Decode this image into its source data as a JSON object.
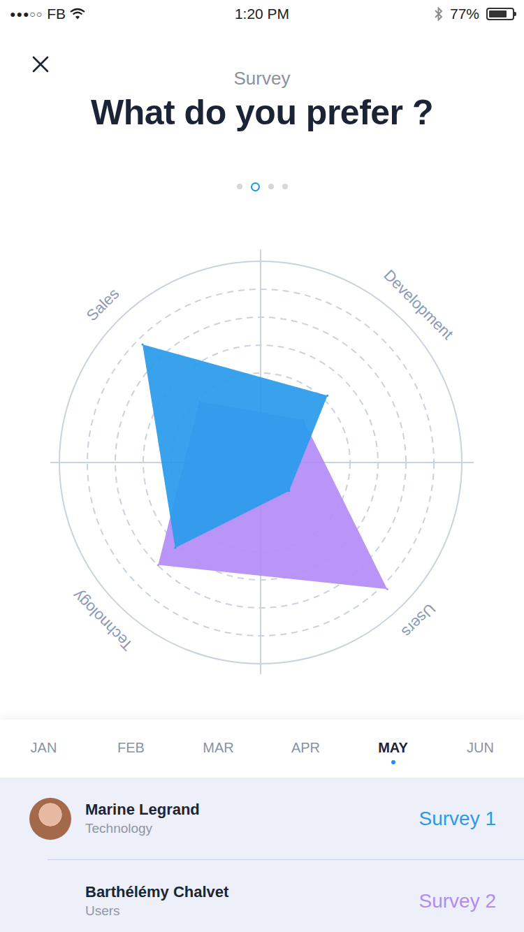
{
  "status_bar": {
    "signal": "●●●○○",
    "carrier": "FB",
    "time": "1:20 PM",
    "battery": "77%",
    "battery_level": 0.77
  },
  "header": {
    "subtitle": "Survey",
    "title": "What do you prefer ?"
  },
  "pager": [
    {
      "selected": false
    },
    {
      "selected": true
    },
    {
      "selected": false
    },
    {
      "selected": false
    }
  ],
  "chart": {
    "axes": [
      "Sales",
      "Development",
      "Users",
      "Technology"
    ],
    "max": 100,
    "series": [
      {
        "color": "#b48ff6",
        "values": [
          43,
          30,
          89,
          72
        ]
      },
      {
        "color": "#2a9bec",
        "values": [
          83,
          47,
          20,
          60
        ]
      }
    ]
  },
  "months": [
    {
      "label": "JAN",
      "selected": false
    },
    {
      "label": "FEB",
      "selected": false
    },
    {
      "label": "MAR",
      "selected": false
    },
    {
      "label": "APR",
      "selected": false
    },
    {
      "label": "MAY",
      "selected": true
    },
    {
      "label": "JUN",
      "selected": false
    }
  ],
  "people": [
    {
      "name": "Marine Legrand",
      "role": "Technology",
      "survey": "Survey 1",
      "color": "#2b9ae6"
    },
    {
      "name": "Barthélémy Chalvet",
      "role": "Users",
      "survey": "Survey 2",
      "color": "#b08cf0"
    }
  ]
}
